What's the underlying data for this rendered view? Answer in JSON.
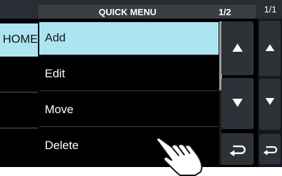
{
  "menu": {
    "title": "QUICK MENU",
    "page_indicator": "1/2",
    "items": [
      {
        "label": "Add",
        "selected": true
      },
      {
        "label": "Edit",
        "selected": false
      },
      {
        "label": "Move",
        "selected": false
      },
      {
        "label": "Delete",
        "selected": false
      }
    ],
    "buttons": {
      "up": "up-arrow-icon",
      "down": "down-arrow-icon",
      "back": "return-icon"
    }
  },
  "background_screen": {
    "page_indicator": "1/1",
    "home_label": "HOME"
  },
  "colors": {
    "selected_item": "#ade4f2",
    "header": "#3a3d42",
    "button": "#2e3137",
    "screen": "#000000"
  },
  "icons": [
    "up-arrow-icon",
    "down-arrow-icon",
    "return-icon",
    "pointing-hand-icon"
  ]
}
